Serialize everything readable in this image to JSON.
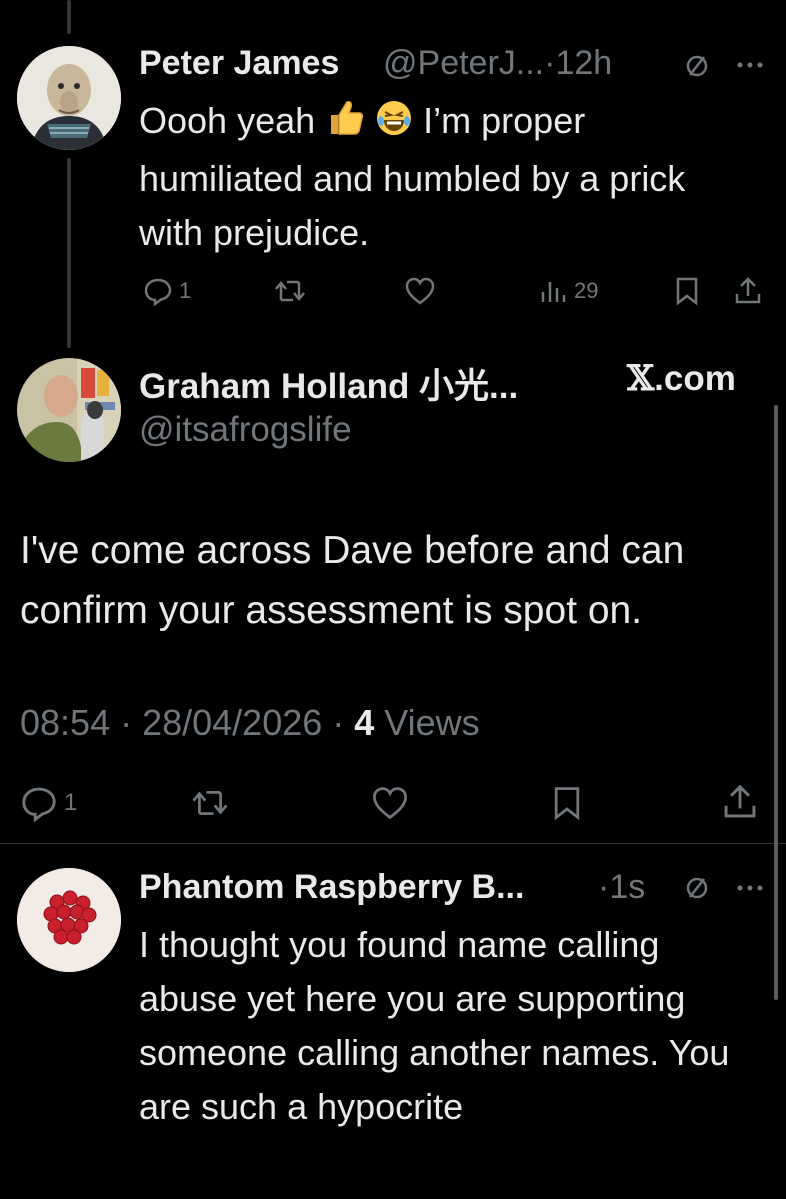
{
  "reply1": {
    "display_name": "Peter James",
    "handle": "@PeterJ...",
    "separator": "·",
    "time": "12h",
    "text_before_emoji": "Oooh yeah ",
    "text_after_emoji": " I’m proper humiliated and humbled by a prick with prejudice.",
    "reply_count": "1",
    "view_count": "29"
  },
  "main_post": {
    "display_name": "Graham Holland 小光...",
    "source": ".com",
    "handle": "@itsafrogslife",
    "text": "I've come across Dave before and can confirm your assessment is spot on.",
    "timestamp": "08:54 · 28/04/2026 · ",
    "views_count": "4",
    "views_label": " Views",
    "reply_count": "1"
  },
  "reply2": {
    "display_name": "Phantom Raspberry B...",
    "separator": "·",
    "time": "1s",
    "text": "I thought you found name calling abuse yet here you are supporting someone calling another names. You are such a hypocrite"
  },
  "colors": {
    "background": "#000000",
    "text": "#e7e9ea",
    "muted": "#71767b",
    "divider": "#2f3336"
  }
}
